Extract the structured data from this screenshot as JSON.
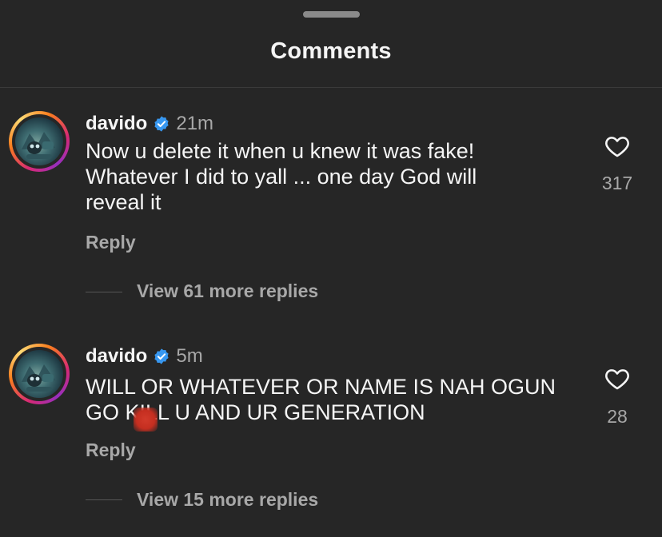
{
  "header": {
    "title": "Comments"
  },
  "colors": {
    "background": "#262626",
    "verified": "#3797f0",
    "muted": "#a8a8a8",
    "text": "#f5f5f5"
  },
  "comments": [
    {
      "username": "davido",
      "verified_icon": "verified-badge-icon",
      "time": "21m",
      "lines": [
        "Now u delete  it when u knew it was fake!",
        "Whatever I did to yall ... one day God  will",
        "reveal it"
      ],
      "reply_label": "Reply",
      "view_replies_label": "View 61 more replies",
      "likes": "317"
    },
    {
      "username": "davido",
      "verified_icon": "verified-badge-icon",
      "time": "5m",
      "lines": [
        "WILL OR WHATEVER OR NAME IS NAH OGUN",
        "GO KILL U AND UR GENERATION"
      ],
      "reply_label": "Reply",
      "view_replies_label": "View 15 more replies",
      "likes": "28"
    }
  ]
}
